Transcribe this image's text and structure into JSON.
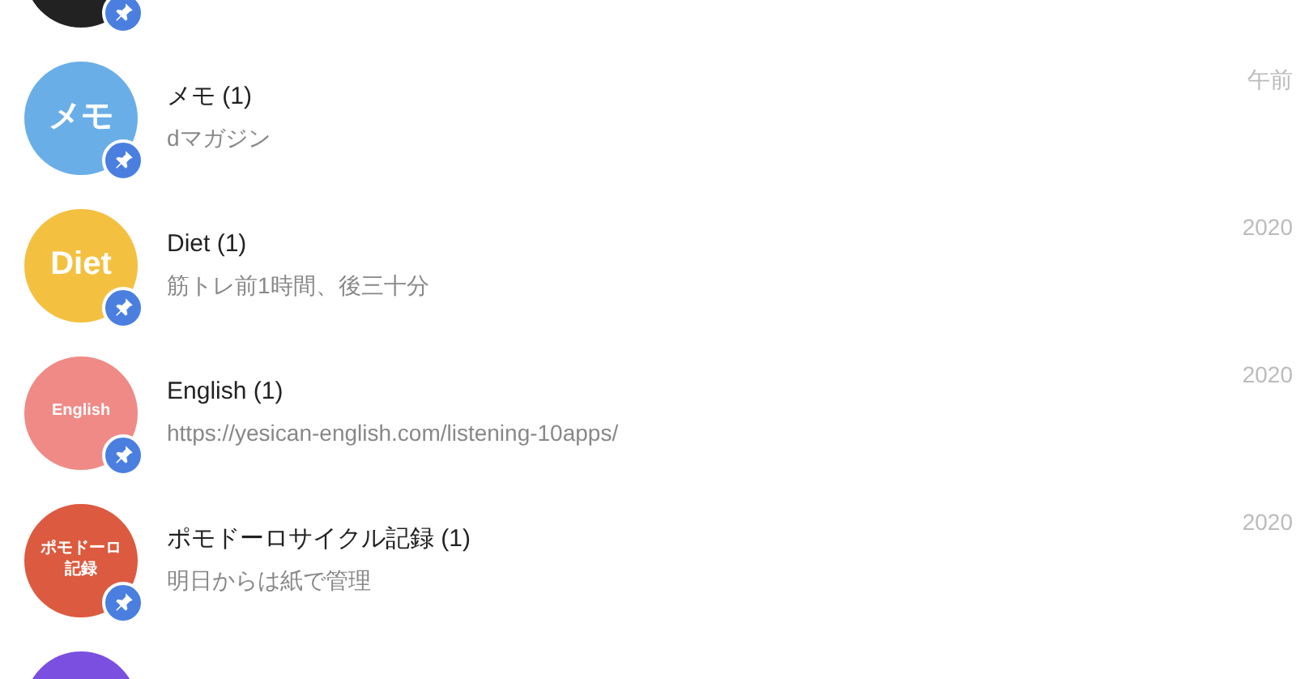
{
  "chats": [
    {
      "color": "#222222",
      "pinned": true
    },
    {
      "avatar_text": "メモ",
      "color": "#6aaee8",
      "pinned": true,
      "title": "メモ (1)",
      "preview": "dマガジン",
      "time": "午前"
    },
    {
      "avatar_text": "Diet",
      "color": "#f4c040",
      "pinned": true,
      "title": "Diet (1)",
      "preview": "筋トレ前1時間、後三十分",
      "time": "2020"
    },
    {
      "avatar_text": "English",
      "color": "#ef8a86",
      "pinned": true,
      "title": "English (1)",
      "preview": "https://yesican-english.com/listening-10apps/",
      "time": "2020"
    },
    {
      "avatar_text": "ポモドーロ記録",
      "color": "#dc5a3f",
      "pinned": true,
      "title": "ポモドーロサイクル記録 (1)",
      "preview": "明日からは紙で管理",
      "time": "2020"
    },
    {
      "color": "#7b4fe0"
    }
  ]
}
